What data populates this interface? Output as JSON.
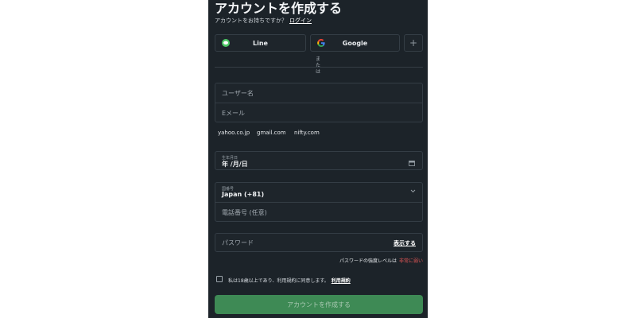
{
  "header": {
    "title": "アカウントを作成する",
    "subtitle": "アカウントをお持ちですか？",
    "login_link": "ログイン"
  },
  "social": {
    "line_label": "Line",
    "google_label": "Google",
    "more_symbol": "+"
  },
  "divider_text": "または",
  "fields": {
    "username_placeholder": "ユーザー名",
    "email_placeholder": "Eメール",
    "email_domains": [
      "yahoo.co.jp",
      "gmail.com",
      "nifty.com"
    ],
    "birthdate_label": "生年月日",
    "birthdate_value": "年 /月/日",
    "country_label": "国番号",
    "country_value": "Japan (+81)",
    "phone_placeholder": "電話番号 (任意)",
    "password_placeholder": "パスワード",
    "password_toggle": "表示する"
  },
  "password_strength": {
    "label": "パスワードの強度レベルは",
    "value": "非常に弱い"
  },
  "terms": {
    "text": "私は18歳以上であり、利用規約に同意します。",
    "link": "利用規約"
  },
  "submit_label": "アカウントを作成する",
  "colors": {
    "panel_bg": "#1c2329",
    "field_border": "#343d45",
    "submit_bg": "#3e8a55",
    "line_green": "#4cc764",
    "weak_red": "#e05555"
  }
}
